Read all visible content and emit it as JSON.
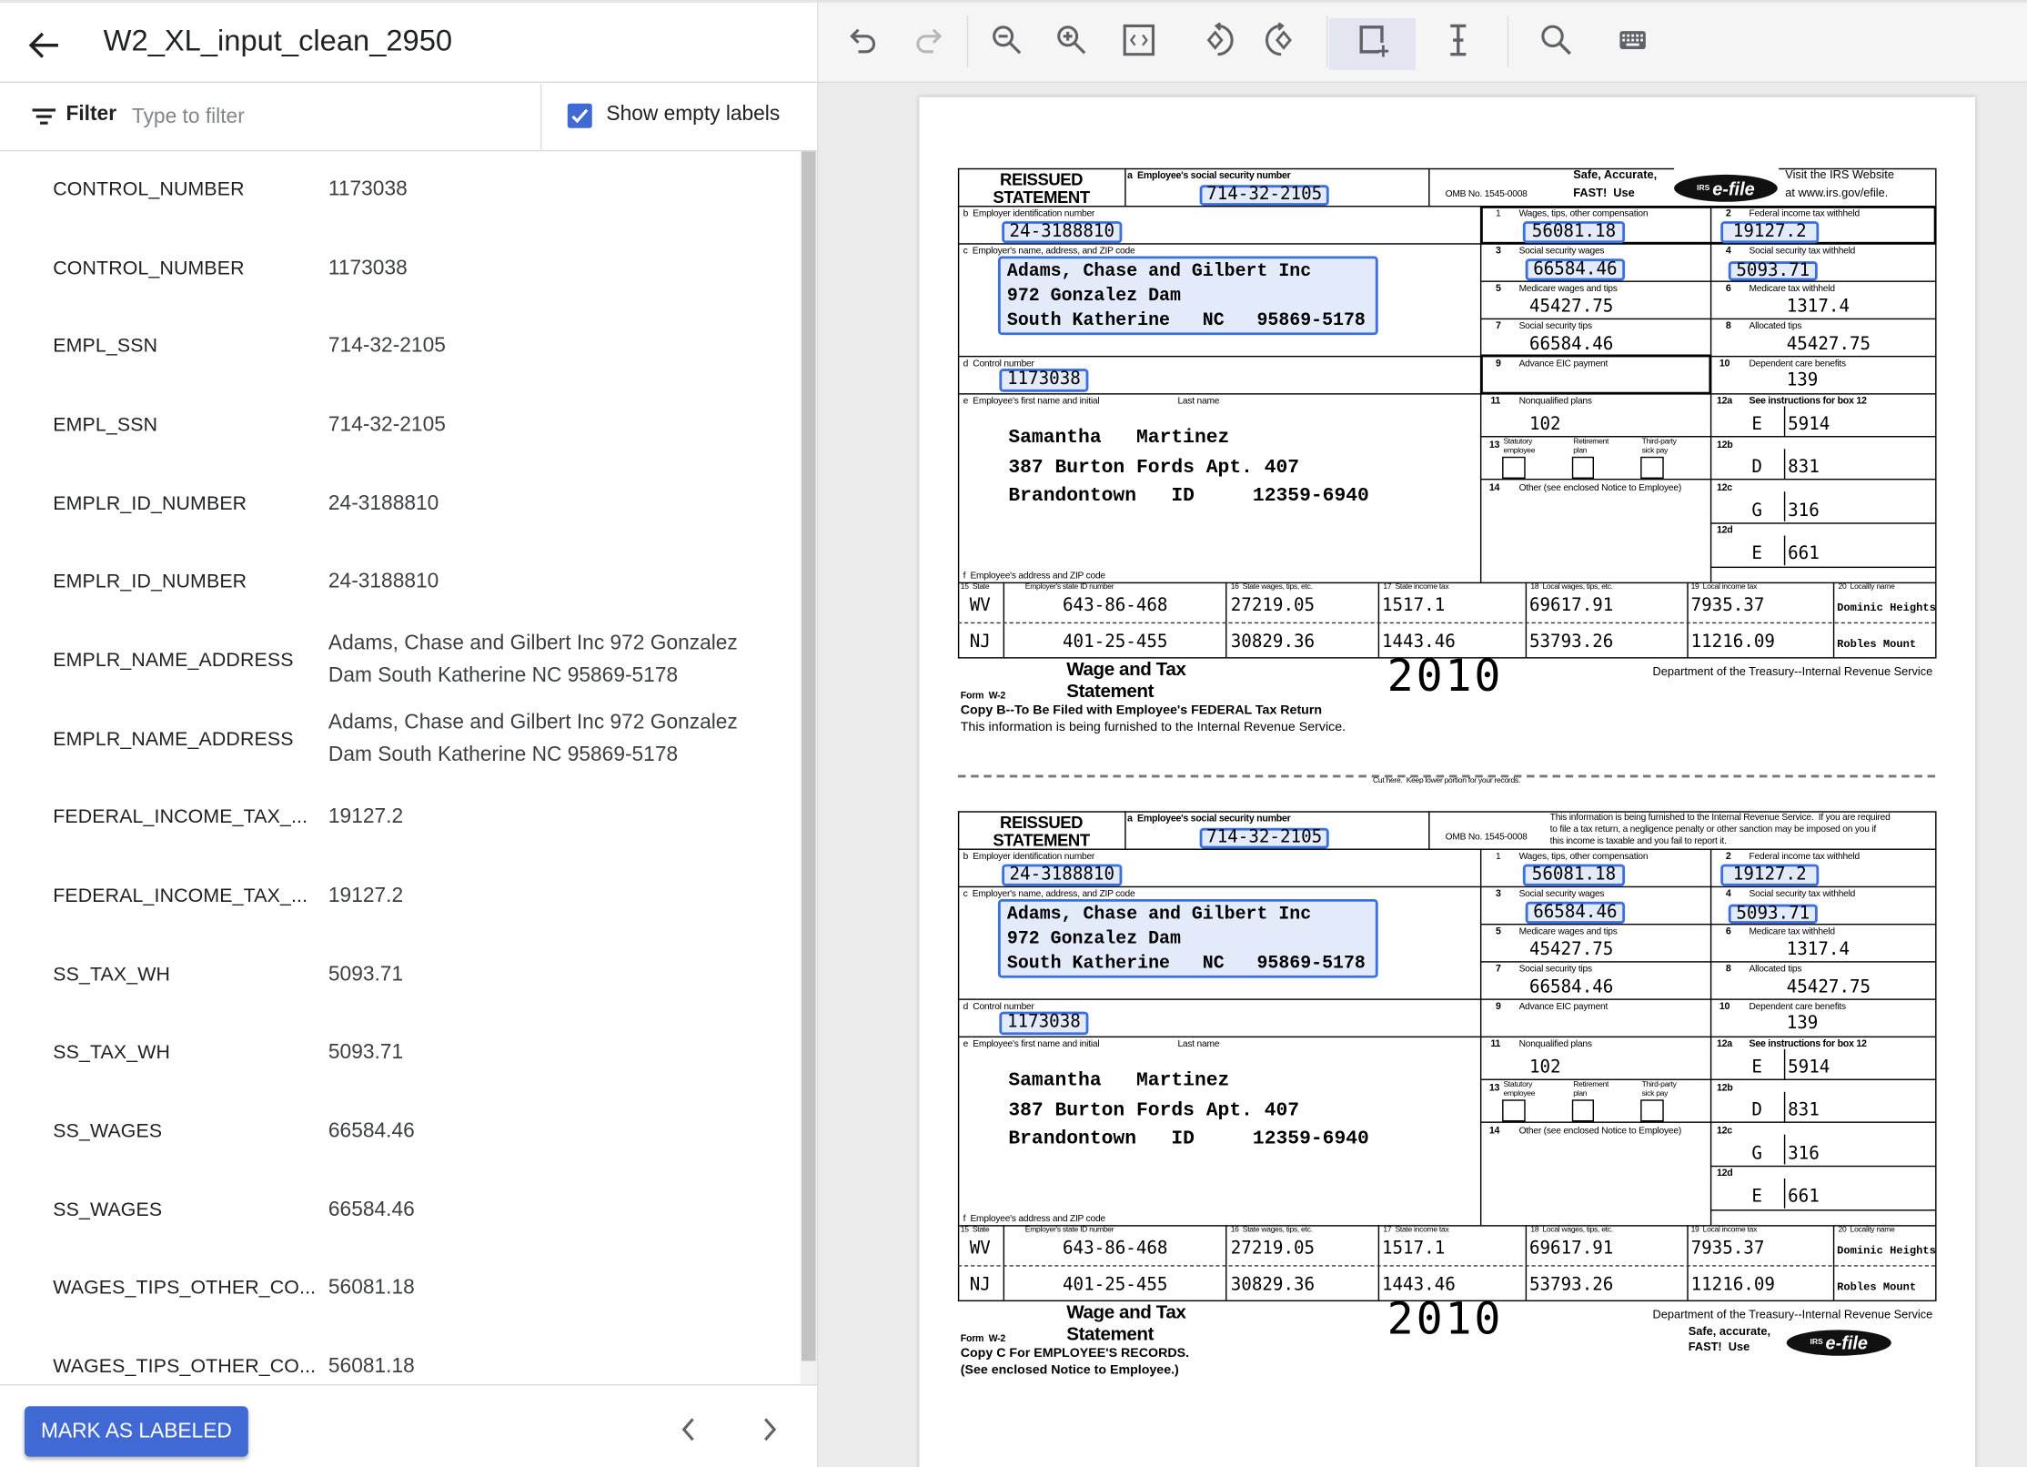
{
  "header": {
    "title": "W2_XL_input_clean_2950",
    "back_icon": "arrow-left-icon"
  },
  "filter": {
    "label": "Filter",
    "placeholder": "Type to filter",
    "icon": "filter-icon",
    "show_empty_label": "Show empty labels",
    "show_empty_checked": true
  },
  "labels_list": [
    {
      "label": "CONTROL_NUMBER",
      "value": "1173038"
    },
    {
      "label": "CONTROL_NUMBER",
      "value": "1173038"
    },
    {
      "label": "EMPL_SSN",
      "value": "714-32-2105"
    },
    {
      "label": "EMPL_SSN",
      "value": "714-32-2105"
    },
    {
      "label": "EMPLR_ID_NUMBER",
      "value": "24-3188810"
    },
    {
      "label": "EMPLR_ID_NUMBER",
      "value": "24-3188810"
    },
    {
      "label": "EMPLR_NAME_ADDRESS",
      "value": "Adams, Chase and Gilbert Inc 972 Gonzalez Dam South Katherine NC 95869-5178"
    },
    {
      "label": "EMPLR_NAME_ADDRESS",
      "value": "Adams, Chase and Gilbert Inc 972 Gonzalez Dam South Katherine NC 95869-5178"
    },
    {
      "label": "FEDERAL_INCOME_TAX_...",
      "value": "19127.2"
    },
    {
      "label": "FEDERAL_INCOME_TAX_...",
      "value": "19127.2"
    },
    {
      "label": "SS_TAX_WH",
      "value": "5093.71"
    },
    {
      "label": "SS_TAX_WH",
      "value": "5093.71"
    },
    {
      "label": "SS_WAGES",
      "value": "66584.46"
    },
    {
      "label": "SS_WAGES",
      "value": "66584.46"
    },
    {
      "label": "WAGES_TIPS_OTHER_CO...",
      "value": "56081.18"
    },
    {
      "label": "WAGES_TIPS_OTHER_CO...",
      "value": "56081.18"
    }
  ],
  "footer": {
    "mark_label": "MARK AS LABELED",
    "prev_icon": "chevron-left-icon",
    "next_icon": "chevron-right-icon"
  },
  "toolbar": {
    "icons": [
      "undo-icon",
      "redo-icon",
      "zoom-out-icon",
      "zoom-in-icon",
      "fit-page-icon",
      "rotate-left-icon",
      "rotate-right-icon",
      "add-bounding-box-icon",
      "text-cursor-icon",
      "search-icon",
      "keyboard-icon"
    ],
    "active": "add-bounding-box-icon",
    "disabled": [
      "redo-icon"
    ]
  },
  "colors": {
    "accent": "#4169d4",
    "highlight_border": "#3a6fe0",
    "highlight_fill": "#e3ebfa"
  },
  "document": {
    "labels": {
      "reissued": "REISSUED",
      "statement": "STATEMENT",
      "a": "a  Employee's social security number",
      "omb": "OMB No. 1545-0008",
      "b": "b  Employer identification number",
      "c": "c  Employer's name, address, and ZIP code",
      "d": "d  Control number",
      "e": "e  Employee's first name and initial",
      "last_name": "Last name",
      "f": "f  Employee's address and ZIP code",
      "box1": [
        "1",
        "Wages, tips, other compensation"
      ],
      "box2": [
        "2",
        "Federal income tax withheld"
      ],
      "box3": [
        "3",
        "Social security wages"
      ],
      "box4": [
        "4",
        "Social security tax withheld"
      ],
      "box5": [
        "5",
        "Medicare wages and tips"
      ],
      "box6": [
        "6",
        "Medicare tax withheld"
      ],
      "box7": [
        "7",
        "Social security tips"
      ],
      "box8": [
        "8",
        "Allocated tips"
      ],
      "box9": [
        "9",
        "Advance EIC payment"
      ],
      "box10": [
        "10",
        "Dependent care benefits"
      ],
      "box11": [
        "11",
        "Nonqualified plans"
      ],
      "box12a": [
        "12a",
        "See instructions for box 12"
      ],
      "box12b": "12b",
      "box12c": "12c",
      "box12d": "12d",
      "box13": "13",
      "box13_opts": [
        [
          "Statutory",
          "employee"
        ],
        [
          "Retirement",
          "plan"
        ],
        [
          "Third-party",
          "sick pay"
        ]
      ],
      "box14": [
        "14",
        "Other (see enclosed Notice to Employee)"
      ],
      "state_headers": [
        "15  State",
        "Employer's state ID number",
        "16  State wages, tips, etc.",
        "17  State income tax",
        "18  Local wages, tips, etc.",
        "19  Local income tax",
        "20  Locality name"
      ],
      "wage_and_tax": "Wage and Tax",
      "statement_word": "Statement",
      "form": "Form  W-2",
      "year": "2010",
      "dept": "Department of the Treasury--Internal Revenue Service",
      "cut": "Cut here.  Keep lower portion for your records.",
      "efile_logo": "e-file",
      "efile_irs": "IRS"
    },
    "values": {
      "ssn": "714-32-2105",
      "ein": "24-3188810",
      "employer": [
        "Adams, Chase and Gilbert Inc",
        "972 Gonzalez Dam",
        "South Katherine   NC   95869-5178"
      ],
      "control": "1173038",
      "wages": "56081.18",
      "fed_tax": "19127.2",
      "ss_wages": "66584.46",
      "ss_tax": "5093.71",
      "medicare_wages": "45427.75",
      "medicare_tax": "1317.4",
      "ss_tips": "66584.46",
      "allocated_tips": "45427.75",
      "dependent_care": "139",
      "nonqualified": "102",
      "box12": [
        [
          "E",
          "5914"
        ],
        [
          "D",
          "831"
        ],
        [
          "G",
          "316"
        ],
        [
          "E",
          "661"
        ]
      ],
      "employee_name": "Samantha   Martinez",
      "employee_address": "387 Burton Fords Apt. 407",
      "employee_city": "Brandontown   ID     12359-6940",
      "states": [
        [
          "WV",
          "643-86-468",
          "27219.05",
          "1517.1",
          "69617.91",
          "7935.37",
          "Dominic Heights"
        ],
        [
          "NJ",
          "401-25-455",
          "30829.36",
          "1443.46",
          "53793.26",
          "11216.09",
          "Robles Mount"
        ]
      ]
    },
    "copies": [
      {
        "safe": [
          "Safe, Accurate,",
          "FAST!  Use"
        ],
        "visit": [
          "Visit the IRS Website",
          "at www.irs.gov/efile."
        ],
        "copy_lines": [
          "Copy B--To Be Filed with Employee's FEDERAL Tax Return",
          "This information is being furnished to the Internal Revenue Service."
        ]
      },
      {
        "note": [
          "This information is being furnished to the Internal Revenue Service.  If you are required",
          "to file a tax return, a negligence penalty or other sanction may be imposed on you if",
          "this income is taxable and you fail to report it."
        ],
        "safe": [
          "Safe, accurate,",
          "FAST!  Use"
        ],
        "copy_lines": [
          "Copy C For EMPLOYEE'S RECORDS.",
          "(See enclosed Notice to Employee.)"
        ]
      }
    ]
  }
}
